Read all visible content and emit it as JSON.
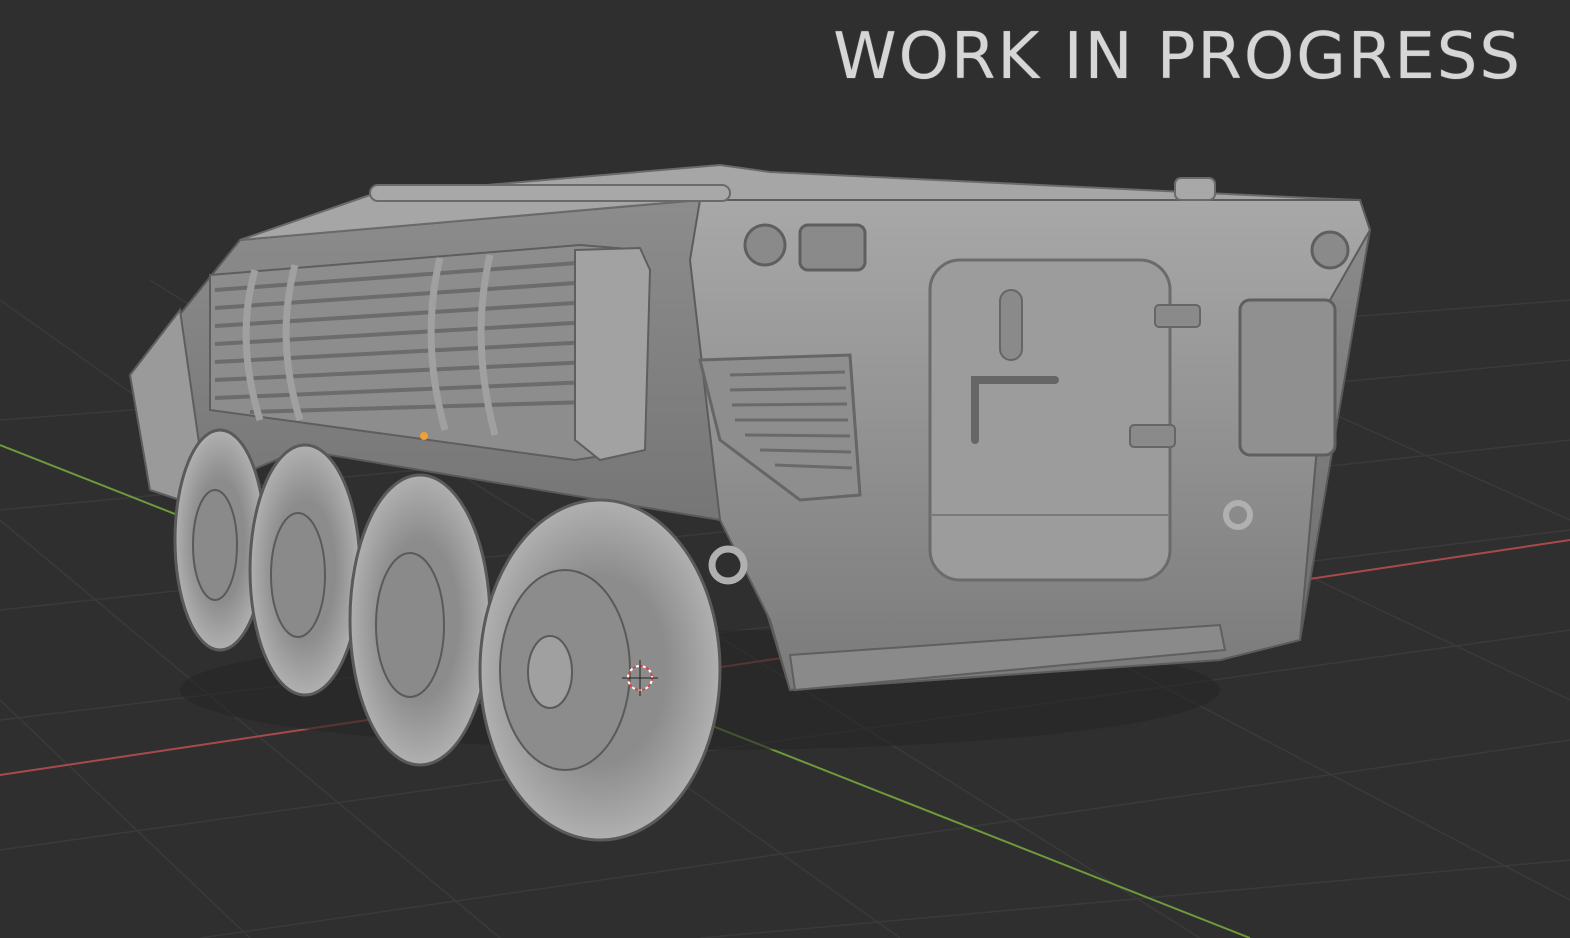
{
  "overlay": {
    "title": "WORK IN PROGRESS"
  },
  "viewport": {
    "background": "#2f2f2f",
    "grid_color": "#3a3a3a",
    "x_axis_color": "#a84a4a",
    "y_axis_color": "#6f9a3a",
    "model_color": "#9a9a9a",
    "origin_marker": "orange-dot",
    "cursor": "3d-cursor-icon"
  }
}
